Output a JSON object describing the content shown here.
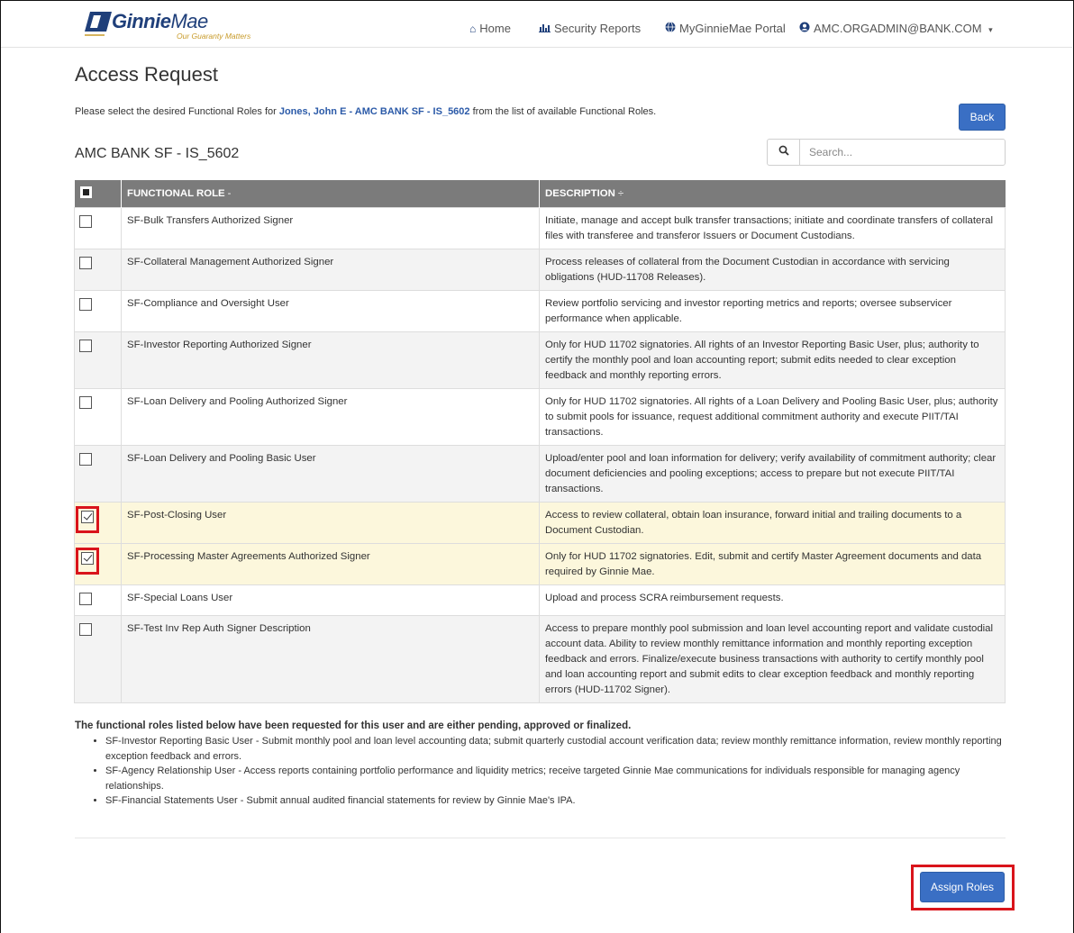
{
  "brand": {
    "name_bold": "Ginnie",
    "name_regular": "Mae",
    "tagline": "Our Guaranty Matters"
  },
  "nav": {
    "home": "Home",
    "reports": "Security Reports",
    "portal": "MyGinnieMae Portal",
    "user": "AMC.ORGADMIN@BANK.COM",
    "user_caret": "▾"
  },
  "page": {
    "title": "Access Request",
    "instruction_prefix": "Please select the desired Functional Roles for ",
    "instruction_user": "Jones, John E - AMC BANK SF - IS_5602",
    "instruction_suffix": " from the list of available Functional Roles.",
    "back_label": "Back",
    "org_name": "AMC BANK SF - IS_5602"
  },
  "search": {
    "placeholder": "Search..."
  },
  "table": {
    "col_role": "FUNCTIONAL ROLE",
    "col_role_sort": "-",
    "col_desc": "DESCRIPTION",
    "col_desc_sort": "÷",
    "rows": [
      {
        "role": "SF-Bulk Transfers Authorized Signer",
        "desc": "Initiate, manage and accept bulk transfer transactions; initiate and coordinate transfers of collateral files with transferee and transferor Issuers or Document Custodians.",
        "checked": false
      },
      {
        "role": "SF-Collateral Management Authorized Signer",
        "desc": "Process releases of collateral from the Document Custodian in accordance with servicing obligations (HUD-11708 Releases).",
        "checked": false
      },
      {
        "role": "SF-Compliance and Oversight User",
        "desc": "Review portfolio servicing and investor reporting metrics and reports; oversee subservicer performance when applicable.",
        "checked": false
      },
      {
        "role": "SF-Investor Reporting Authorized Signer",
        "desc": "Only for HUD 11702 signatories. All rights of an Investor Reporting Basic User, plus; authority to certify the monthly pool and loan accounting report; submit edits needed to clear exception feedback and monthly reporting errors.",
        "checked": false
      },
      {
        "role": "SF-Loan Delivery and Pooling Authorized Signer",
        "desc": "Only for HUD 11702 signatories. All rights of a Loan Delivery and Pooling Basic User, plus; authority to submit pools for issuance, request additional commitment authority and execute PIIT/TAI transactions.",
        "checked": false
      },
      {
        "role": "SF-Loan Delivery and Pooling Basic User",
        "desc": "Upload/enter pool and loan information for delivery; verify availability of commitment authority; clear document deficiencies and pooling exceptions; access to prepare but not execute PIIT/TAI transactions.",
        "checked": false
      },
      {
        "role": "SF-Post-Closing User",
        "desc": "Access to review collateral, obtain loan insurance, forward initial and trailing documents to a Document Custodian.",
        "checked": true
      },
      {
        "role": "SF-Processing Master Agreements Authorized Signer",
        "desc": "Only for HUD 11702 signatories. Edit, submit and certify Master Agreement documents and data required by Ginnie Mae.",
        "checked": true
      },
      {
        "role": "SF-Special Loans User",
        "desc": "Upload and process SCRA reimbursement requests.",
        "checked": false
      },
      {
        "role": "SF-Test Inv Rep Auth Signer Description",
        "desc": "Access to prepare monthly pool submission and loan level accounting report and validate custodial account data. Ability to review monthly remittance information and monthly reporting exception feedback and errors. Finalize/execute business transactions with authority to certify monthly pool and loan accounting report and submit edits to clear exception feedback and monthly reporting errors (HUD-11702 Signer).",
        "checked": false
      }
    ]
  },
  "notes": {
    "heading": "The functional roles listed below have been requested for this user and are either pending, approved or finalized.",
    "items": [
      "SF-Investor Reporting Basic User - Submit monthly pool and loan level accounting data; submit quarterly custodial account verification data; review monthly remittance information, review monthly reporting exception feedback and errors.",
      "SF-Agency Relationship User - Access reports containing portfolio performance and liquidity metrics; receive targeted Ginnie Mae communications for individuals responsible for managing agency relationships.",
      "SF-Financial Statements User - Submit annual audited financial statements for review by Ginnie Mae's IPA."
    ]
  },
  "actions": {
    "assign_label": "Assign Roles"
  },
  "colors": {
    "primary": "#3a6fc4",
    "header_bg": "#7b7b7b",
    "highlight": "#d9141b",
    "selected_row": "#fcf7dc",
    "link": "#2b5aa8"
  }
}
